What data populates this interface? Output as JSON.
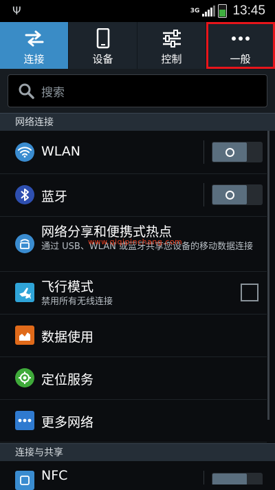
{
  "status_bar": {
    "network_type": "3G",
    "time": "13:45"
  },
  "tabs": [
    {
      "label": "连接",
      "icon": "swap-arrows-icon",
      "active": true
    },
    {
      "label": "设备",
      "icon": "phone-icon",
      "active": false
    },
    {
      "label": "控制",
      "icon": "sliders-icon",
      "active": false
    },
    {
      "label": "一般",
      "icon": "more-dots-icon",
      "active": false,
      "highlighted": true
    }
  ],
  "search": {
    "placeholder": "搜索"
  },
  "sections": {
    "network": "网络连接",
    "connect_share": "连接与共享"
  },
  "items": {
    "wlan": {
      "title": "WLAN",
      "icon": "wifi-icon",
      "toggle": "off"
    },
    "bluetooth": {
      "title": "蓝牙",
      "icon": "bluetooth-icon",
      "toggle": "off"
    },
    "tethering": {
      "title": "网络分享和便携式热点",
      "subtitle": "通过 USB、WLAN 或蓝牙共享您设备的移动数据连接",
      "icon": "hotspot-icon"
    },
    "airplane": {
      "title": "飞行模式",
      "subtitle": "禁用所有无线连接",
      "icon": "airplane-icon",
      "checked": false
    },
    "data_usage": {
      "title": "数据使用",
      "icon": "data-usage-icon"
    },
    "location": {
      "title": "定位服务",
      "icon": "location-icon"
    },
    "more_networks": {
      "title": "更多网络",
      "icon": "more-networks-icon"
    },
    "nfc": {
      "title": "NFC",
      "icon": "nfc-icon",
      "toggle": "off"
    }
  },
  "watermark": "www.qiqipinchang.com",
  "colors": {
    "accent": "#3a8cc6",
    "highlight_border": "#e8151b",
    "background": "#0b0d10"
  }
}
